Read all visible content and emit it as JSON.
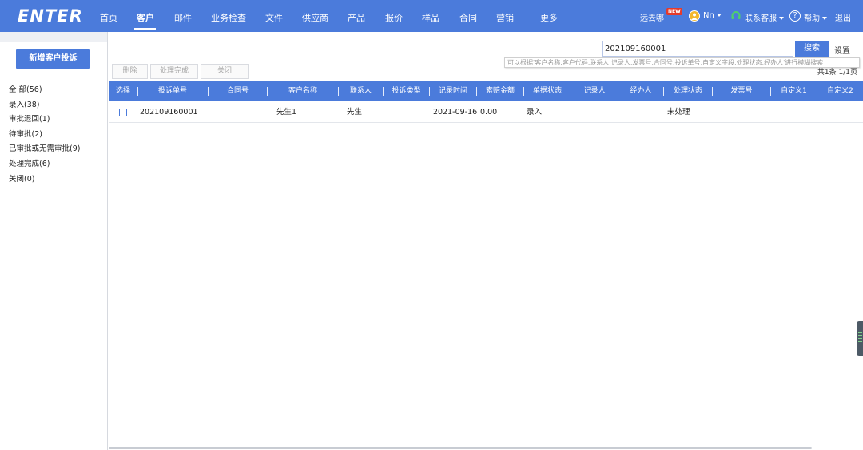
{
  "brand": {
    "logo_text": "ENTER"
  },
  "nav": {
    "items": [
      "首页",
      "客户",
      "邮件",
      "业务检查",
      "文件",
      "供应商",
      "产品",
      "报价",
      "样品",
      "合同",
      "营销",
      "更多"
    ],
    "active": "客户"
  },
  "header_right": {
    "promo_label": "远去哪",
    "promo_badge": "NEW",
    "user_name": "Nn",
    "support_label": "联系客服",
    "help_label": "帮助",
    "logout_label": "退出"
  },
  "sidebar": {
    "new_button": "新增客户投诉",
    "filters": [
      "全 部(56)",
      "录入(38)",
      "审批退回(1)",
      "待审批(2)",
      "已审批或无需审批(9)",
      "处理完成(6)",
      "关闭(0)"
    ]
  },
  "toolbar": {
    "delete_label": "删除",
    "complete_label": "处理完成",
    "close_label": "关闭"
  },
  "search": {
    "value": "202109160001",
    "button_label": "搜索",
    "settings_label": "设置",
    "hint": "可以根据'客户名称,客户代码,联系人,记录人,发票号,合同号,投诉单号,自定义字段,处理状态,经办人'进行模糊搜索"
  },
  "pager": {
    "text": "共1条 1/1页"
  },
  "table": {
    "columns": [
      "选择",
      "投诉单号",
      "合同号",
      "客户名称",
      "联系人",
      "投诉类型",
      "记录时间",
      "索赔金额",
      "单据状态",
      "记录人",
      "经办人",
      "处理状态",
      "发票号",
      "自定义1",
      "自定义2"
    ],
    "rows": [
      {
        "complaint_no": "202109160001",
        "contract_no": "",
        "customer_name": "先生1",
        "contact": "先生",
        "complaint_type": "",
        "record_time": "2021-09-16",
        "claim_amount": "0.00",
        "doc_status": "录入",
        "recorder": "",
        "handler": "",
        "process_status": "未处理",
        "invoice_no": "",
        "custom1": "",
        "custom2": ""
      }
    ]
  },
  "colors": {
    "primary": "#4b7bdb",
    "badge_red": "#e63a2b",
    "sidebar_band": "#eef0f4"
  },
  "icons": {
    "user": "avatar-icon",
    "support": "headset-icon",
    "help": "help-circle-icon",
    "dropdown": "caret-down-icon"
  }
}
